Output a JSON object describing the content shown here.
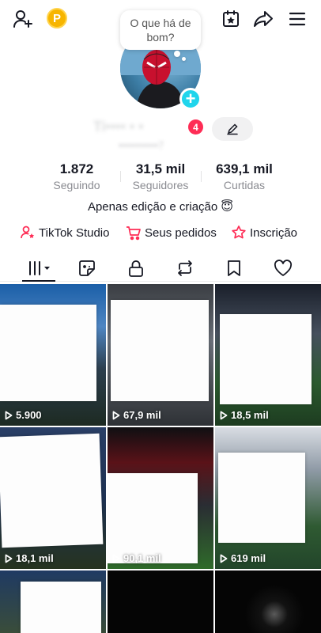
{
  "header": {
    "coin_label": "P",
    "speech_bubble": "O que há de bom?"
  },
  "profile": {
    "username": "Ti•••• • •",
    "handle": "•••••••••••7",
    "notification_count": "4",
    "bio": "Apenas edição e criação 😇"
  },
  "stats": [
    {
      "value": "1.872",
      "label": "Seguindo"
    },
    {
      "value": "31,5 mil",
      "label": "Seguidores"
    },
    {
      "value": "639,1 mil",
      "label": "Curtidas"
    }
  ],
  "links": [
    {
      "label": "TikTok Studio",
      "icon": "person-star-icon"
    },
    {
      "label": "Seus pedidos",
      "icon": "cart-icon"
    },
    {
      "label": "Inscrição",
      "icon": "star-badge-icon"
    }
  ],
  "tabs": [
    {
      "name": "videos",
      "icon": "grid-bars-icon",
      "active": true
    },
    {
      "name": "reposts-sticker",
      "icon": "sticker-icon"
    },
    {
      "name": "private",
      "icon": "lock-icon"
    },
    {
      "name": "reposts",
      "icon": "repost-icon"
    },
    {
      "name": "favorites",
      "icon": "bookmark-icon"
    },
    {
      "name": "liked",
      "icon": "heart-icon"
    }
  ],
  "videos": [
    {
      "views": "5.900"
    },
    {
      "views": "67,9 mil"
    },
    {
      "views": "18,5 mil"
    },
    {
      "views": "18,1 mil"
    },
    {
      "views": "90,1 mil"
    },
    {
      "views": "619 mil"
    },
    {
      "views": ""
    },
    {
      "views": ""
    },
    {
      "views": ""
    }
  ],
  "colors": {
    "accent": "#fe2c55",
    "avatar_add": "#20d5ec",
    "text": "#161823",
    "muted": "#8a8b91"
  }
}
